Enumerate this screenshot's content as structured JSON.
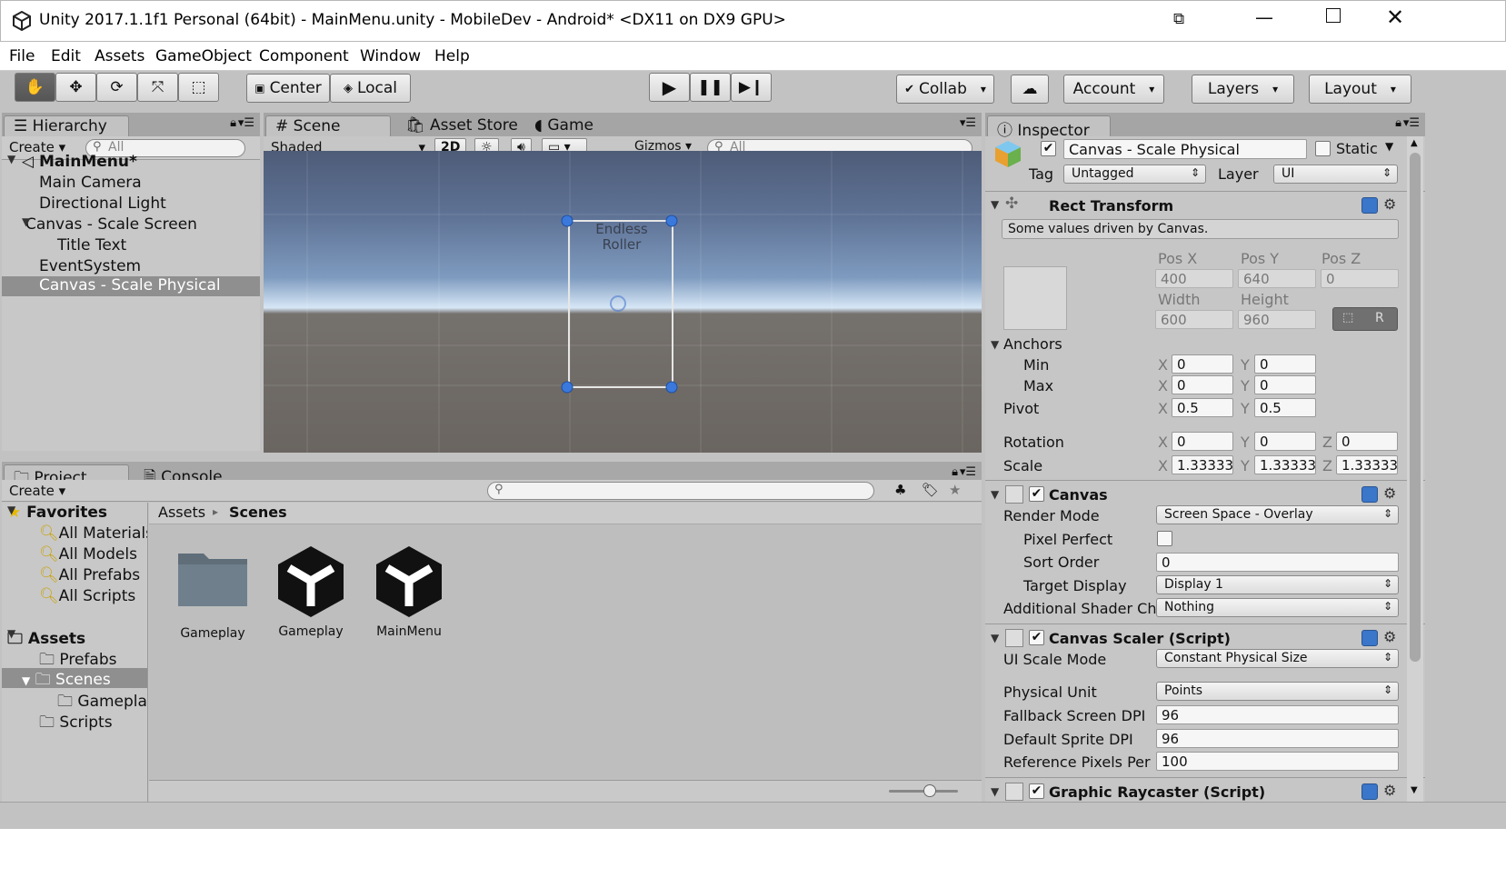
{
  "window": {
    "title": "Unity 2017.1.1f1 Personal (64bit) - MainMenu.unity - MobileDev - Android* <DX11 on DX9 GPU>"
  },
  "menu": [
    "File",
    "Edit",
    "Assets",
    "GameObject",
    "Component",
    "Window",
    "Help"
  ],
  "toolbar": {
    "pivot": "Center",
    "space": "Local",
    "collab": "Collab",
    "account": "Account",
    "layers": "Layers",
    "layout": "Layout"
  },
  "hierarchy": {
    "tab": "Hierarchy",
    "create": "Create",
    "search": "All",
    "scene": "MainMenu*",
    "items": [
      "Main Camera",
      "Directional Light",
      "Canvas - Scale Screen",
      "Title Text",
      "EventSystem",
      "Canvas - Scale Physical"
    ]
  },
  "scene": {
    "tabs": [
      "Scene",
      "Asset Store",
      "Game"
    ],
    "shading": "Shaded",
    "mode2d": "2D",
    "gizmos": "Gizmos",
    "search": "All",
    "canvas_text": [
      "Endless",
      "Roller"
    ]
  },
  "project": {
    "tabs": [
      "Project",
      "Console"
    ],
    "create": "Create",
    "favorites_label": "Favorites",
    "favorites": [
      "All Materials",
      "All Models",
      "All Prefabs",
      "All Scripts"
    ],
    "assets_label": "Assets",
    "folders": [
      "Prefabs",
      "Scenes",
      "Gameplay",
      "Scripts"
    ],
    "breadcrumb": [
      "Assets",
      "Scenes"
    ],
    "items": [
      "Gameplay",
      "Gameplay",
      "MainMenu"
    ]
  },
  "inspector": {
    "tab": "Inspector",
    "object_name": "Canvas - Scale Physical",
    "static_label": "Static",
    "tag_label": "Tag",
    "tag_value": "Untagged",
    "layer_label": "Layer",
    "layer_value": "UI",
    "rect": {
      "title": "Rect Transform",
      "note": "Some values driven by Canvas.",
      "pos_labels": [
        "Pos X",
        "Pos Y",
        "Pos Z"
      ],
      "pos_values": [
        "400",
        "640",
        "0"
      ],
      "size_labels": [
        "Width",
        "Height"
      ],
      "size_values": [
        "600",
        "960"
      ],
      "r_button": "R",
      "anchors": "Anchors",
      "min": "Min",
      "max": "Max",
      "min_x": "0",
      "min_y": "0",
      "max_x": "0",
      "max_y": "0",
      "pivot": "Pivot",
      "pivot_x": "0.5",
      "pivot_y": "0.5",
      "rotation": "Rotation",
      "rot_x": "0",
      "rot_y": "0",
      "rot_z": "0",
      "scale": "Scale",
      "scale_x": "1.33333",
      "scale_y": "1.33333",
      "scale_z": "1.33333",
      "x": "X",
      "y": "Y",
      "z": "Z"
    },
    "canvas": {
      "title": "Canvas",
      "render_mode_label": "Render Mode",
      "render_mode": "Screen Space - Overlay",
      "pixel_perfect_label": "Pixel Perfect",
      "sort_order_label": "Sort Order",
      "sort_order": "0",
      "target_display_label": "Target Display",
      "target_display": "Display 1",
      "shader_label": "Additional Shader Ch",
      "shader_value": "Nothing"
    },
    "scaler": {
      "title": "Canvas Scaler (Script)",
      "ui_scale_label": "UI Scale Mode",
      "ui_scale": "Constant Physical Size",
      "unit_label": "Physical Unit",
      "unit": "Points",
      "fallback_label": "Fallback Screen DPI",
      "fallback": "96",
      "sprite_label": "Default Sprite DPI",
      "sprite": "96",
      "ref_label": "Reference Pixels Per",
      "ref": "100"
    },
    "raycaster": {
      "title": "Graphic Raycaster (Script)"
    }
  }
}
